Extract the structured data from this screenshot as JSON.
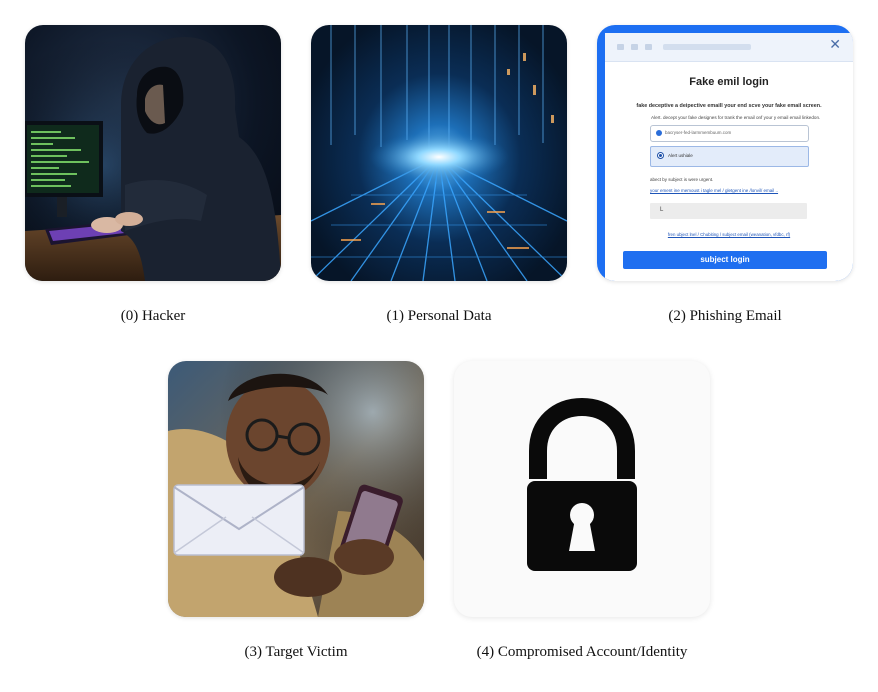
{
  "nodes": [
    {
      "index": "(0)",
      "label": "Hacker",
      "icon": "hooded-hacker-at-computer"
    },
    {
      "index": "(1)",
      "label": "Personal Data",
      "icon": "digital-data-stream"
    },
    {
      "index": "(2)",
      "label": "Phishing Email",
      "icon": "fake-login-email"
    },
    {
      "index": "(3)",
      "label": "Target Victim",
      "icon": "person-reading-phone-with-envelope"
    },
    {
      "index": "(4)",
      "label": "Compromised Account/Identity",
      "icon": "padlock-icon"
    }
  ],
  "phishing_email": {
    "title": "Fake emil login",
    "subtitle": "fake deceptive a deipective emaill your end scve your fake email screen.",
    "description": "Alert. decept your fake designes for trank the email onf your y email email linkedon.",
    "field_email": "bacryser-fed-larmmembuum.com",
    "field_alert": "Alert  ushiale",
    "line_urgent": "abect by subject is were urgent.",
    "line_link": "your ement ine memoust i tagle mel / gletgent ine /lonvil/ email ..",
    "field_input": "L",
    "link_footer": "fren ubject lnel / Chubiting / subject email (weanation, vfdbc, rf)",
    "button_label": "subject login",
    "close_glyph": "✕"
  },
  "colors": {
    "phishing_accent": "#1f6ff0",
    "lock": "#0a0a0a"
  }
}
